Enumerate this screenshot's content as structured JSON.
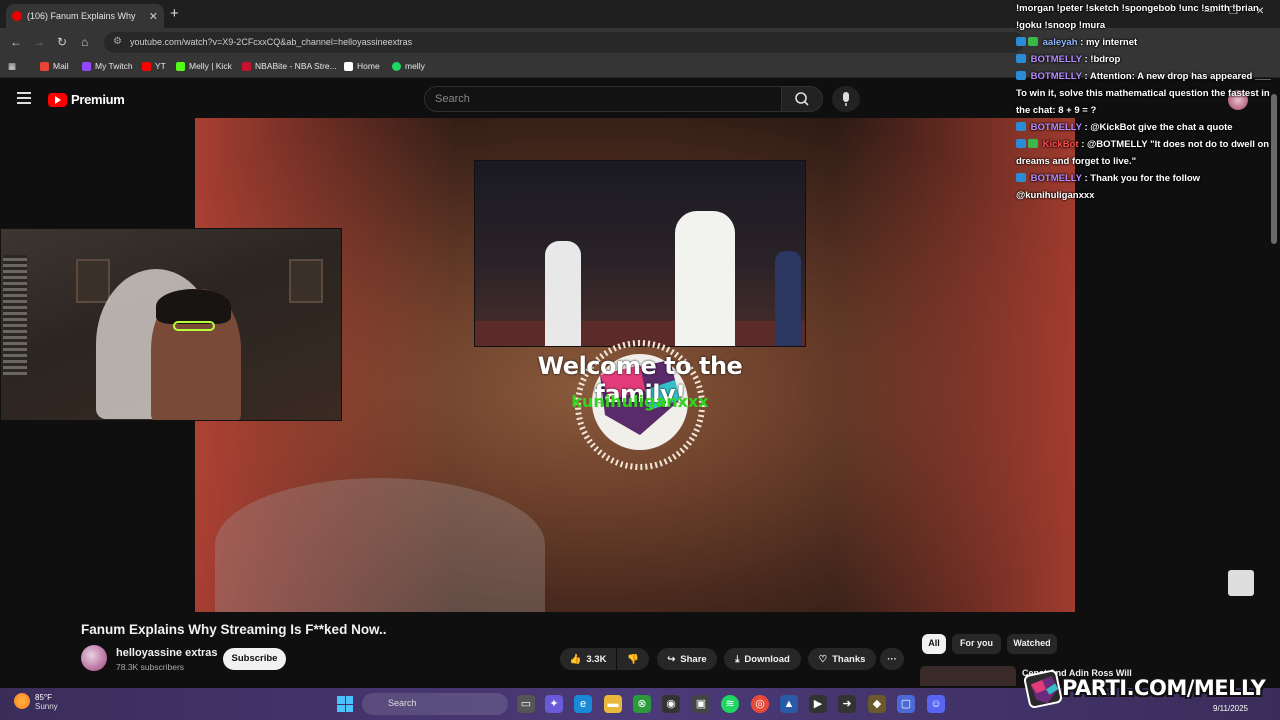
{
  "browser": {
    "tab_title": "(106) Fanum Explains Why",
    "new_tab": "+",
    "url": "youtube.com/watch?v=X9-2CFcxxCQ&ab_channel=helloyassineextras",
    "bookmarks": [
      {
        "label": "Mail",
        "color": "#ea4335"
      },
      {
        "label": "My Twitch",
        "color": "#9146ff"
      },
      {
        "label": "YT",
        "color": "#ff0000"
      },
      {
        "label": "Melly | Kick",
        "color": "#53fc18"
      },
      {
        "label": "NBABite - NBA Stre...",
        "color": "#c9102f"
      },
      {
        "label": "Home",
        "color": "#ffffff"
      },
      {
        "label": "melly",
        "color": "#1ed760"
      }
    ]
  },
  "youtube": {
    "logo_text": "Premium",
    "search_placeholder": "Search",
    "video_title": "Fanum Explains Why Streaming Is F**ked Now..",
    "channel_name": "helloyassine extras",
    "subscribers": "78.3K subscribers",
    "subscribe_label": "Subscribe",
    "like_count": "3.3K",
    "share_label": "Share",
    "download_label": "Download",
    "thanks_label": "Thanks",
    "more_label": "···",
    "chips": [
      "All",
      "For you",
      "Watched"
    ],
    "recommended_title": "Cenat And Adin Ross Will"
  },
  "overlay": {
    "welcome_text": "Welcome to the family!",
    "follower_name": "kunihuliganxxx",
    "brand_text": "PARTI.COM/MELLY"
  },
  "chat": {
    "lines": [
      {
        "user": "",
        "text": "!morgan !peter !sketch !spongebob !unc !smith !brian !goku !snoop !mura",
        "color": "#ffffff"
      },
      {
        "user": "aaleyah",
        "text": ": my internet",
        "color": "#8fb6ff"
      },
      {
        "user": "BOTMELLY",
        "text": ": !bdrop",
        "color": "#b48cff"
      },
      {
        "user": "BOTMELLY",
        "text": ": Attention: A new drop has appeared ___ To win it, solve this mathematical question the fastest in the chat: 8 + 9 = ?",
        "color": "#b48cff"
      },
      {
        "user": "BOTMELLY",
        "text": ": @KickBot give the chat a quote",
        "color": "#b48cff"
      },
      {
        "user": "KickBot",
        "text": ": @BOTMELLY \"It does not do to dwell on dreams and forget to live.\"",
        "color": "#ff4a4a"
      },
      {
        "user": "BOTMELLY",
        "text": ": Thank you for the follow @kunihuliganxxx",
        "color": "#b48cff"
      }
    ]
  },
  "taskbar": {
    "temp": "85°F",
    "condition": "Sunny",
    "search_label": "Search",
    "date": "9/11/2025"
  }
}
